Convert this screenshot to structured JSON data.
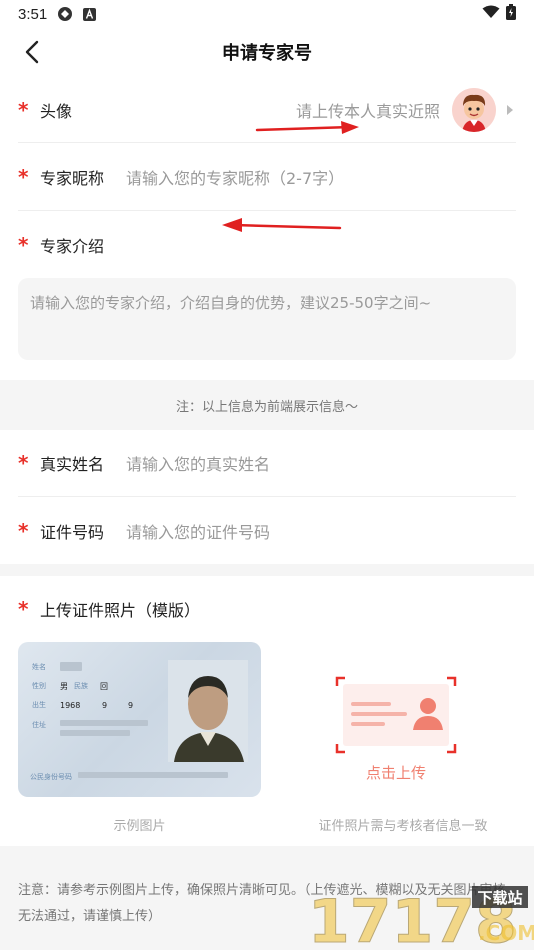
{
  "status": {
    "time": "3:51"
  },
  "nav": {
    "title": "申请专家号"
  },
  "form": {
    "avatar": {
      "label": "头像",
      "hint": "请上传本人真实近照"
    },
    "nickname": {
      "label": "专家昵称",
      "placeholder": "请输入您的专家昵称（2-7字）"
    },
    "intro": {
      "label": "专家介绍",
      "placeholder": "请输入您的专家介绍，介绍自身的优势，建议25-50字之间~"
    },
    "note": "注：以上信息为前端展示信息～",
    "real_name": {
      "label": "真实姓名",
      "placeholder": "请输入您的真实姓名"
    },
    "id_number": {
      "label": "证件号码",
      "placeholder": "请输入您的证件号码"
    },
    "upload": {
      "label": "上传证件照片（模版）",
      "sample_caption": "示例图片",
      "upload_text": "点击上传",
      "upload_caption": "证件照片需与考核者信息一致"
    },
    "footer_note": "注意：请参考示例图片上传，确保照片清晰可见。（上传遮光、模糊以及无关图片审核无法通过，请谨慎上传）"
  },
  "id_card_sample": {
    "fields": [
      "姓名",
      "性别",
      "民族",
      "出生",
      "住址",
      "公民身份号码"
    ],
    "values": {
      "gender": "男",
      "ethnicity": "回",
      "birth_year": "1968",
      "birth_month": "9",
      "birth_day": "9"
    }
  },
  "watermark": {
    "text": "17178",
    "sub": "下载站",
    "domain": ".COM"
  },
  "colors": {
    "accent": "#e8312a",
    "upload_accent": "#f08070",
    "arrow": "#e02020"
  }
}
